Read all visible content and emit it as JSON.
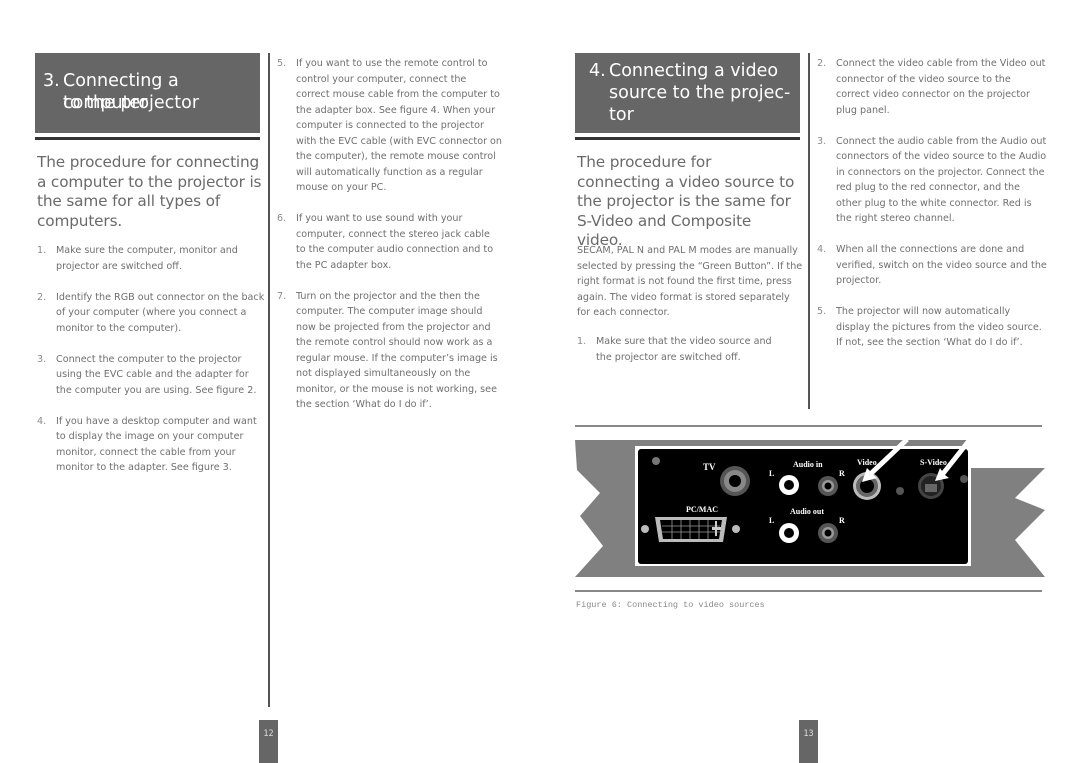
{
  "left_page": {
    "section_number": "3.",
    "section_title_line1": "Connecting a computer",
    "section_title_line2": "to the projector",
    "intro": "The procedure for connecting a computer to the projector is the same for all types of computers.",
    "steps_col1": [
      {
        "n": "1.",
        "text": "Make sure the computer, monitor and projector are switched off."
      },
      {
        "n": "2.",
        "text": "Identify the RGB out connector on the back of your computer (where you connect a monitor to the computer)."
      },
      {
        "n": "3.",
        "text": "Connect the computer to the projector using the EVC cable and the adapter for the computer you are using. See figure 2."
      },
      {
        "n": "4.",
        "text": "If you have a desktop computer and want to display the image on your computer monitor, connect the cable from your monitor to the adapter. See figure 3."
      }
    ],
    "steps_col2": [
      {
        "n": "5.",
        "text": "If you want to use the remote control to control your computer, connect the correct mouse cable from the computer to the adapter box. See figure 4. When your computer is connected to the projector with the EVC cable (with EVC connector on the computer), the remote mouse control will automatically function as a regular mouse on your PC."
      },
      {
        "n": "6.",
        "text": "If you want to use sound with your computer, connect the stereo jack cable to the computer audio connection and to the PC adapter box."
      },
      {
        "n": "7.",
        "text": "Turn on the projector and the then the computer. The computer image should now be projected from the projector and the remote control should now work as a regular mouse. If the computer’s image is not displayed simultaneously on the monitor, or the mouse is not working, see the section ‘What do I do if’."
      }
    ],
    "page_number": "12"
  },
  "right_page": {
    "section_number": "4.",
    "section_title_line1": "Connecting a video",
    "section_title_line2": "source to the projec-",
    "section_title_line3": "tor",
    "intro": "The procedure for connecting a video source to the projector is the same for S-Video and Composite video.",
    "note": "SECAM, PAL N and PAL M modes are manually selected by pressing the “Green Button”. If the right format is not found the first time, press again. The video format is stored separately for each connector.",
    "steps_col1": [
      {
        "n": "1.",
        "text": "Make sure that the video source and the projector are switched off."
      }
    ],
    "steps_col2": [
      {
        "n": "2.",
        "text": "Connect the video cable from the Video out connector of the video source to the correct video connector on the projector plug panel."
      },
      {
        "n": "3.",
        "text": "Connect the audio cable from the Audio out connectors of the video source to the Audio in connectors on the projector. Connect the red plug to the red connector, and the other plug to the white connector. Red is the right stereo channel."
      },
      {
        "n": "4.",
        "text": "When all the connections are done and verified, switch on the video source and the projector."
      },
      {
        "n": "5.",
        "text": "The projector will now automatically display the pictures from the video source. If not, see the section ‘What do I do if’."
      }
    ],
    "figure": {
      "caption": "Figure 6: Connecting to video sources",
      "labels": {
        "tv": "TV",
        "pcmac": "PC/MAC",
        "audio_in": "Audio in",
        "audio_out": "Audio out",
        "left": "L",
        "right": "R",
        "video": "Video",
        "svideo": "S-Video"
      }
    },
    "page_number": "13"
  }
}
